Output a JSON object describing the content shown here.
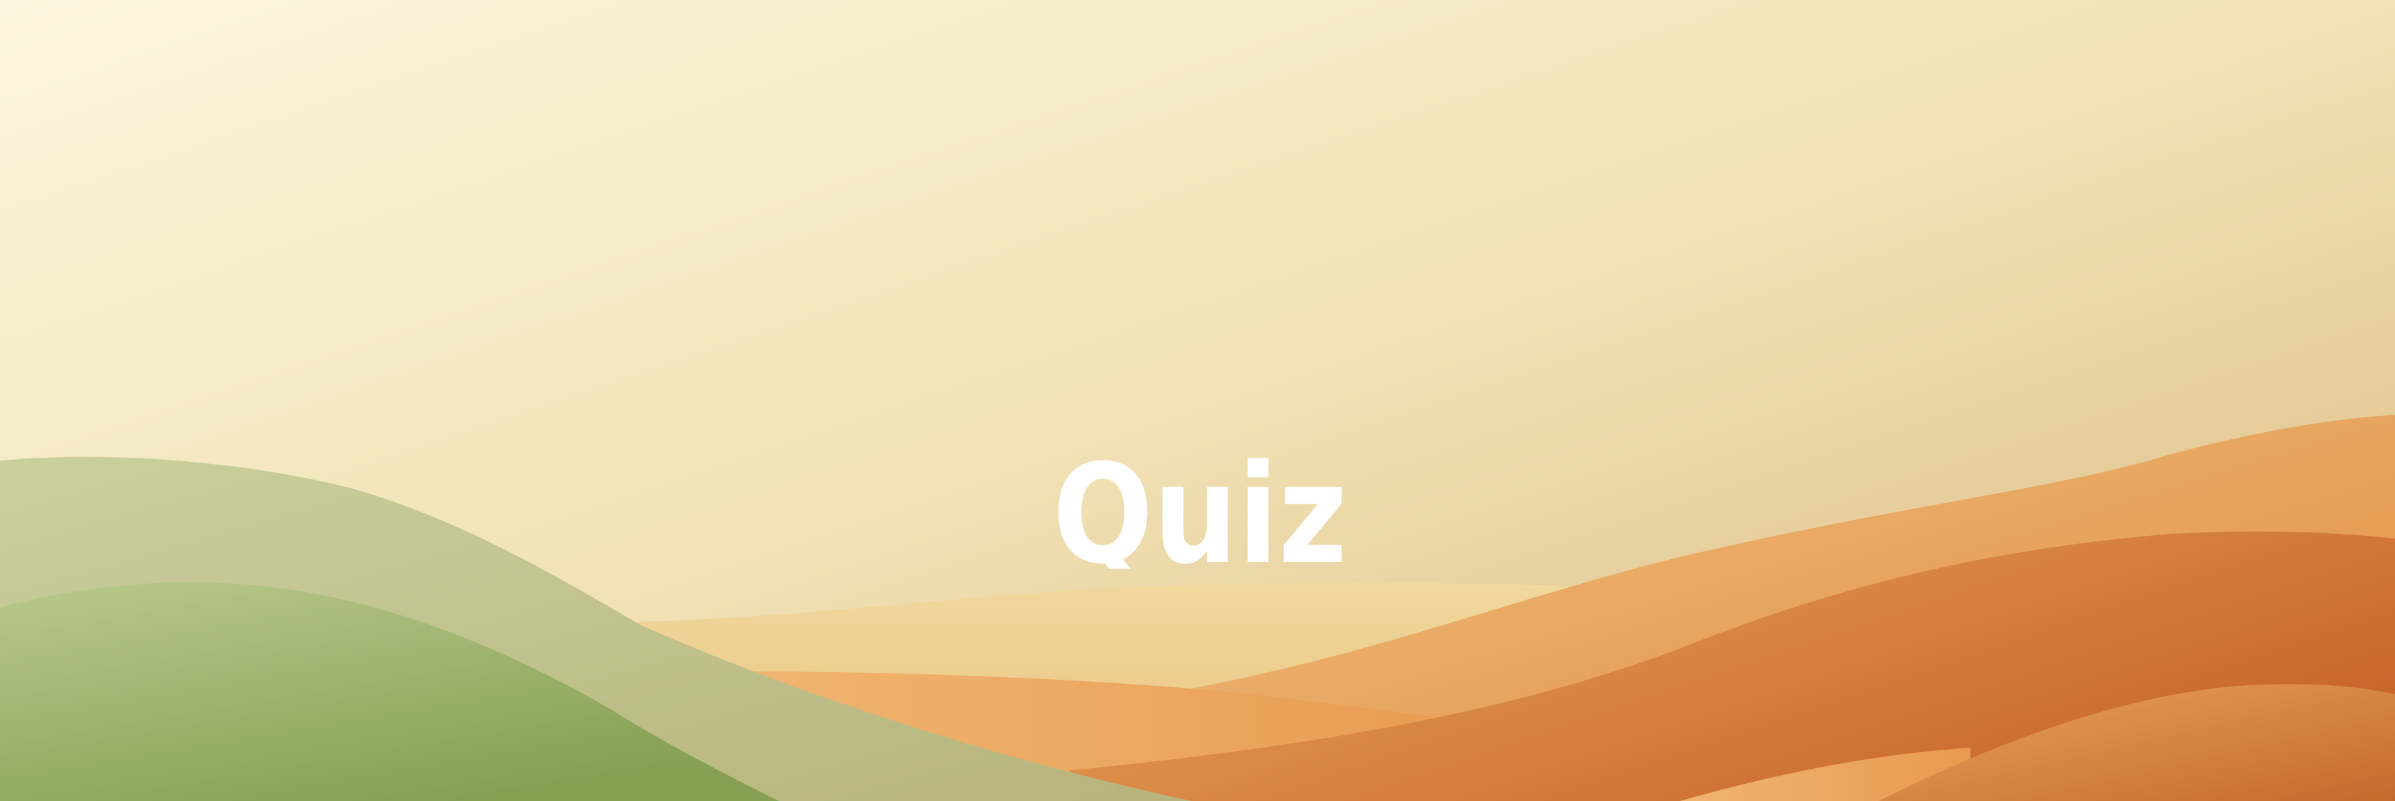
{
  "banner": {
    "logo_text": "Quiz",
    "colors": {
      "sky_top": "#fcf5dc",
      "sky_bottom_right": "#dcbd85",
      "green_hill": "#9fb46a",
      "orange_dune": "#e79a4c",
      "logo": "#ffffff"
    }
  }
}
